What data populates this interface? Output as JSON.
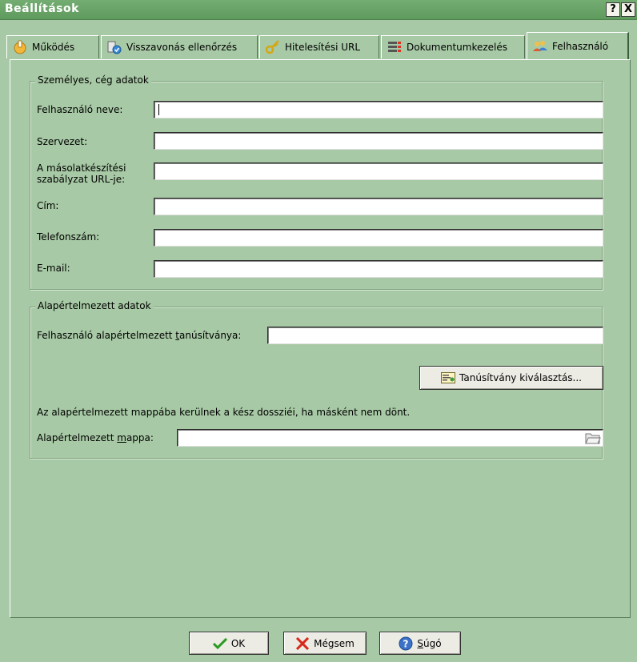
{
  "window": {
    "title": "Beállítások",
    "help_glyph": "?",
    "close_glyph": "X"
  },
  "tabs": [
    {
      "label": "Működés",
      "icon": "operation-icon"
    },
    {
      "label": "Visszavonás ellenőrzés",
      "icon": "revocation-icon"
    },
    {
      "label": "Hitelesítési URL",
      "icon": "key-icon"
    },
    {
      "label": "Dokumentumkezelés",
      "icon": "document-list-icon"
    },
    {
      "label": "Felhasználó",
      "icon": "users-icon",
      "active": true
    }
  ],
  "personal_group": {
    "legend": "Személyes, cég adatok",
    "fields": [
      {
        "label": "Felhasználó neve:",
        "value": ""
      },
      {
        "label": "Szervezet:",
        "value": ""
      },
      {
        "label": "A másolatkészítési szabályzat URL-je:",
        "value": ""
      },
      {
        "label": "Cím:",
        "value": ""
      },
      {
        "label": "Telefonszám:",
        "value": ""
      },
      {
        "label": "E-mail:",
        "value": ""
      }
    ]
  },
  "default_group": {
    "legend": "Alapértelmezett adatok",
    "cert_label_pre": "Felhasználó alapértelmezett ",
    "cert_label_accel": "t",
    "cert_label_post": "anúsítványa:",
    "cert_value": "",
    "select_cert_button": "Tanúsítvány kiválasztás...",
    "info_text": "Az alapértelmezett mappába kerülnek a kész dossziéi, ha másként nem dönt.",
    "folder_label_pre": "Alapértelmezett ",
    "folder_label_accel": "m",
    "folder_label_post": "appa:",
    "folder_value": ""
  },
  "footer": {
    "ok": "OK",
    "cancel": "Mégsem",
    "help_accel": "S",
    "help_rest": "úgó"
  },
  "colors": {
    "background": "#a7c9a5",
    "titlebar": "#6aa468"
  }
}
